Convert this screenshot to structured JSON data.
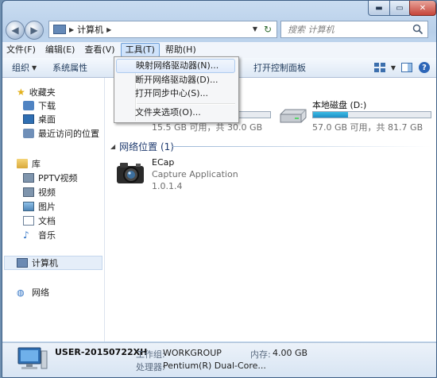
{
  "window": {
    "address": {
      "location": "计算机"
    },
    "search": {
      "placeholder": "搜索 计算机"
    }
  },
  "menubar": [
    {
      "label": "文件(F)"
    },
    {
      "label": "编辑(E)"
    },
    {
      "label": "查看(V)"
    },
    {
      "label": "工具(T)",
      "active": true
    },
    {
      "label": "帮助(H)"
    }
  ],
  "toolbar": {
    "organize": "组织",
    "system_properties": "系统属性",
    "open_control_panel": "打开控制面板"
  },
  "tools_menu": {
    "items": [
      {
        "label": "映射网络驱动器(N)..."
      },
      {
        "label": "断开网络驱动器(D)..."
      },
      {
        "label": "打开同步中心(S)..."
      },
      {
        "label": "文件夹选项(O)..."
      }
    ]
  },
  "nav": {
    "favorites": "收藏夹",
    "downloads": "下载",
    "desktop": "桌面",
    "recent": "最近访问的位置",
    "libraries": "库",
    "pptv": "PPTV视频",
    "videos": "视频",
    "pictures": "图片",
    "documents": "文档",
    "music": "音乐",
    "computer": "计算机",
    "network": "网络"
  },
  "drives": [
    {
      "name": "",
      "free_text": "15.5 GB 可用，共 30.0 GB",
      "used_fraction": 0.48
    },
    {
      "name": "本地磁盘 (D:)",
      "free_text": "57.0 GB 可用，共 81.7 GB",
      "used_fraction": 0.3
    }
  ],
  "network_group": {
    "label": "网络位置 (1)"
  },
  "network_item": {
    "name": "ECap",
    "description": "Capture Application",
    "version": "1.0.1.4"
  },
  "details": {
    "computer_name": "USER-20150722XH",
    "workgroup_label": "工作组:",
    "workgroup_value": "WORKGROUP",
    "memory_label": "内存:",
    "memory_value": "4.00 GB",
    "processor_label": "处理器:",
    "processor_value": "Pentium(R) Dual-Core..."
  },
  "colors": {
    "accent": "#1f8fc6",
    "menu_highlight": "#dfeafb"
  }
}
